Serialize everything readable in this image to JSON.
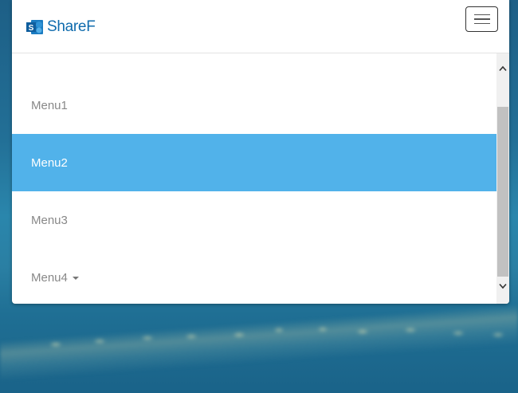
{
  "brand": {
    "name": "ShareF",
    "logo_icon": "sharepoint-logo-icon",
    "color": "#0f6bad"
  },
  "navbar": {
    "toggle_icon": "hamburger-menu-icon"
  },
  "menu": {
    "items": [
      {
        "label": "Menu1",
        "active": false,
        "dropdown": false
      },
      {
        "label": "Menu2",
        "active": true,
        "dropdown": false
      },
      {
        "label": "Menu3",
        "active": false,
        "dropdown": false
      },
      {
        "label": "Menu4",
        "active": false,
        "dropdown": true,
        "dropdown_icon": "caret-down-icon"
      }
    ],
    "active_color": "#51b2ea",
    "text_color": "#888888"
  },
  "scrollbar": {
    "up_icon": "chevron-up-icon",
    "down_icon": "chevron-down-icon"
  }
}
